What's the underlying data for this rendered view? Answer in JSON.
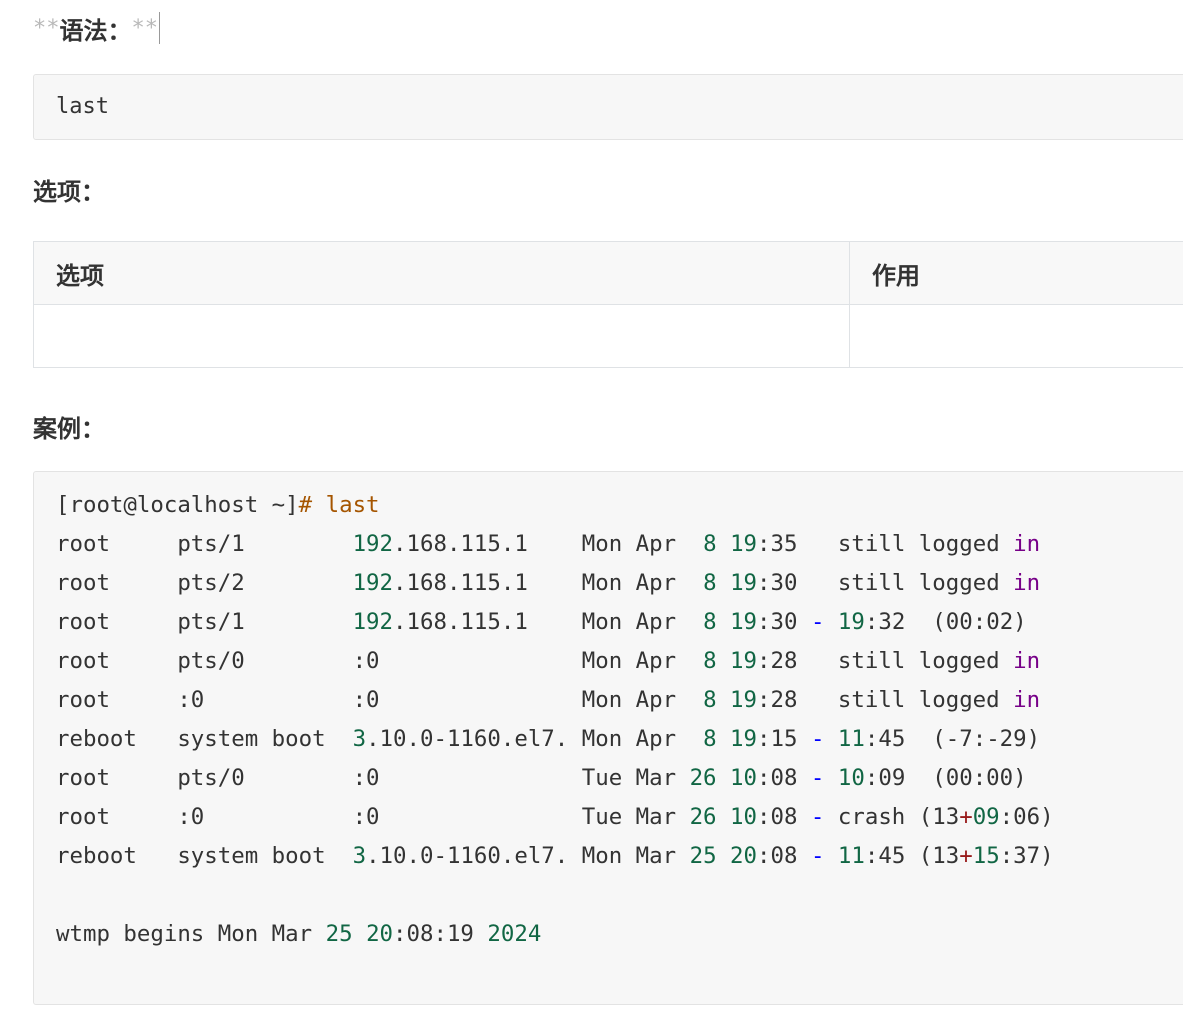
{
  "syntax_heading": {
    "md_open": "**",
    "text": "语法：",
    "md_close": "**"
  },
  "syntax_code": "last",
  "options_heading": "选项：",
  "options_table": {
    "headers": [
      "选项",
      "作用"
    ],
    "rows": [
      [
        "",
        ""
      ]
    ]
  },
  "example_heading": "案例：",
  "example_code": {
    "lines": [
      [
        {
          "t": "[root@localhost ~]",
          "c": "pl"
        },
        {
          "t": "# last",
          "c": "cmd"
        }
      ],
      [
        {
          "t": "root     pts/1        ",
          "c": "pl"
        },
        {
          "t": "192",
          "c": "num"
        },
        {
          "t": ".168.115.1    Mon Apr  ",
          "c": "pl"
        },
        {
          "t": "8",
          "c": "num"
        },
        {
          "t": " ",
          "c": "pl"
        },
        {
          "t": "19",
          "c": "num"
        },
        {
          "t": ":35   still logged ",
          "c": "pl"
        },
        {
          "t": "in",
          "c": "kw"
        }
      ],
      [
        {
          "t": "root     pts/2        ",
          "c": "pl"
        },
        {
          "t": "192",
          "c": "num"
        },
        {
          "t": ".168.115.1    Mon Apr  ",
          "c": "pl"
        },
        {
          "t": "8",
          "c": "num"
        },
        {
          "t": " ",
          "c": "pl"
        },
        {
          "t": "19",
          "c": "num"
        },
        {
          "t": ":30   still logged ",
          "c": "pl"
        },
        {
          "t": "in",
          "c": "kw"
        }
      ],
      [
        {
          "t": "root     pts/1        ",
          "c": "pl"
        },
        {
          "t": "192",
          "c": "num"
        },
        {
          "t": ".168.115.1    Mon Apr  ",
          "c": "pl"
        },
        {
          "t": "8",
          "c": "num"
        },
        {
          "t": " ",
          "c": "pl"
        },
        {
          "t": "19",
          "c": "num"
        },
        {
          "t": ":30 ",
          "c": "pl"
        },
        {
          "t": "-",
          "c": "dash"
        },
        {
          "t": " ",
          "c": "pl"
        },
        {
          "t": "19",
          "c": "num"
        },
        {
          "t": ":32  (00:02)",
          "c": "pl"
        }
      ],
      [
        {
          "t": "root     pts/0        :0               Mon Apr  ",
          "c": "pl"
        },
        {
          "t": "8",
          "c": "num"
        },
        {
          "t": " ",
          "c": "pl"
        },
        {
          "t": "19",
          "c": "num"
        },
        {
          "t": ":28   still logged ",
          "c": "pl"
        },
        {
          "t": "in",
          "c": "kw"
        }
      ],
      [
        {
          "t": "root     :0           :0               Mon Apr  ",
          "c": "pl"
        },
        {
          "t": "8",
          "c": "num"
        },
        {
          "t": " ",
          "c": "pl"
        },
        {
          "t": "19",
          "c": "num"
        },
        {
          "t": ":28   still logged ",
          "c": "pl"
        },
        {
          "t": "in",
          "c": "kw"
        }
      ],
      [
        {
          "t": "reboot   system boot  ",
          "c": "pl"
        },
        {
          "t": "3",
          "c": "num"
        },
        {
          "t": ".10.0-1160.el7. Mon Apr  ",
          "c": "pl"
        },
        {
          "t": "8",
          "c": "num"
        },
        {
          "t": " ",
          "c": "pl"
        },
        {
          "t": "19",
          "c": "num"
        },
        {
          "t": ":15 ",
          "c": "pl"
        },
        {
          "t": "-",
          "c": "dash"
        },
        {
          "t": " ",
          "c": "pl"
        },
        {
          "t": "11",
          "c": "num"
        },
        {
          "t": ":45  (-7:-29)",
          "c": "pl"
        }
      ],
      [
        {
          "t": "root     pts/0        :0               Tue Mar ",
          "c": "pl"
        },
        {
          "t": "26",
          "c": "num"
        },
        {
          "t": " ",
          "c": "pl"
        },
        {
          "t": "10",
          "c": "num"
        },
        {
          "t": ":08 ",
          "c": "pl"
        },
        {
          "t": "-",
          "c": "dash"
        },
        {
          "t": " ",
          "c": "pl"
        },
        {
          "t": "10",
          "c": "num"
        },
        {
          "t": ":09  (00:00)",
          "c": "pl"
        }
      ],
      [
        {
          "t": "root     :0           :0               Tue Mar ",
          "c": "pl"
        },
        {
          "t": "26",
          "c": "num"
        },
        {
          "t": " ",
          "c": "pl"
        },
        {
          "t": "10",
          "c": "num"
        },
        {
          "t": ":08 ",
          "c": "pl"
        },
        {
          "t": "-",
          "c": "dash"
        },
        {
          "t": " crash (13",
          "c": "pl"
        },
        {
          "t": "+",
          "c": "op"
        },
        {
          "t": "09",
          "c": "num"
        },
        {
          "t": ":06)",
          "c": "pl"
        }
      ],
      [
        {
          "t": "reboot   system boot  ",
          "c": "pl"
        },
        {
          "t": "3",
          "c": "num"
        },
        {
          "t": ".10.0-1160.el7. Mon Mar ",
          "c": "pl"
        },
        {
          "t": "25",
          "c": "num"
        },
        {
          "t": " ",
          "c": "pl"
        },
        {
          "t": "20",
          "c": "num"
        },
        {
          "t": ":08 ",
          "c": "pl"
        },
        {
          "t": "-",
          "c": "dash"
        },
        {
          "t": " ",
          "c": "pl"
        },
        {
          "t": "11",
          "c": "num"
        },
        {
          "t": ":45 (13",
          "c": "pl"
        },
        {
          "t": "+",
          "c": "op"
        },
        {
          "t": "15",
          "c": "num"
        },
        {
          "t": ":37)",
          "c": "pl"
        }
      ],
      [],
      [
        {
          "t": "wtmp begins Mon Mar ",
          "c": "pl"
        },
        {
          "t": "25",
          "c": "num"
        },
        {
          "t": " ",
          "c": "pl"
        },
        {
          "t": "20",
          "c": "num"
        },
        {
          "t": ":08:19 ",
          "c": "pl"
        },
        {
          "t": "2024",
          "c": "num"
        }
      ]
    ]
  },
  "colors": {
    "number": "#116644",
    "keyword": "#770088",
    "operator": "#981a1a",
    "range_dash": "#0000ff",
    "command": "#a55500",
    "plain": "#333333",
    "code_background": "#f7f7f7"
  }
}
